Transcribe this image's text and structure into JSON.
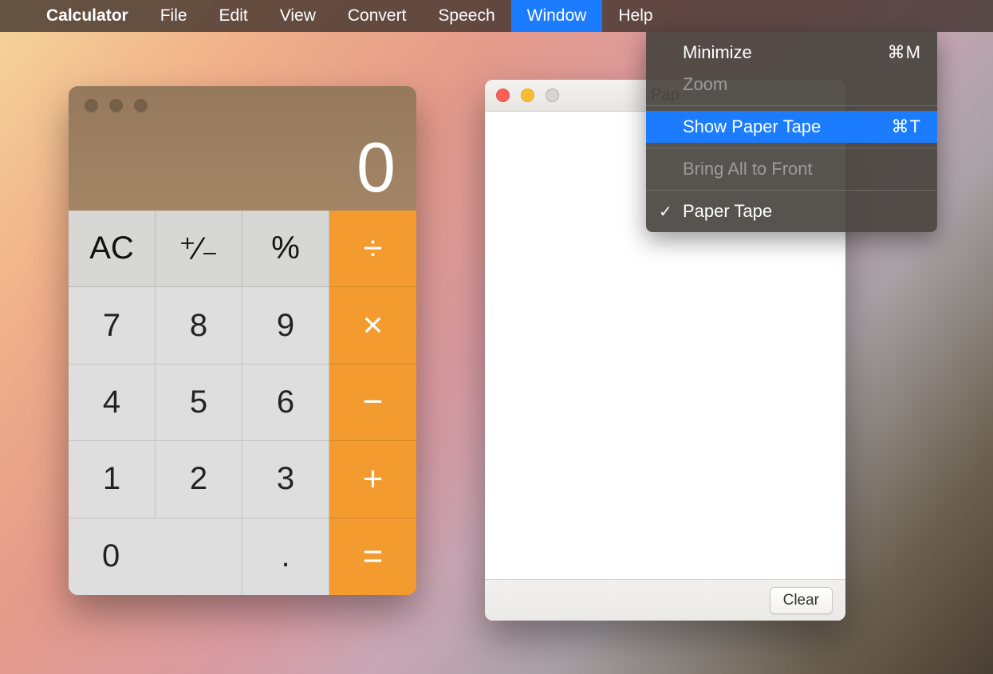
{
  "menubar": {
    "app": "Calculator",
    "items": [
      "File",
      "Edit",
      "View",
      "Convert",
      "Speech",
      "Window",
      "Help"
    ],
    "active": "Window"
  },
  "dropdown": {
    "minimize": {
      "label": "Minimize",
      "shortcut": "⌘M"
    },
    "zoom": {
      "label": "Zoom"
    },
    "showTape": {
      "label": "Show Paper Tape",
      "shortcut": "⌘T"
    },
    "bringFront": {
      "label": "Bring All to Front"
    },
    "paperTape": {
      "label": "Paper Tape"
    }
  },
  "calculator": {
    "display": "0",
    "keys": {
      "ac": "AC",
      "sign": "⁺∕₋",
      "percent": "%",
      "div": "÷",
      "mul": "×",
      "sub": "−",
      "add": "+",
      "eq": "=",
      "d7": "7",
      "d8": "8",
      "d9": "9",
      "d4": "4",
      "d5": "5",
      "d6": "6",
      "d1": "1",
      "d2": "2",
      "d3": "3",
      "d0": "0",
      "dot": "."
    }
  },
  "paperTape": {
    "title": "Pap",
    "clear": "Clear"
  }
}
